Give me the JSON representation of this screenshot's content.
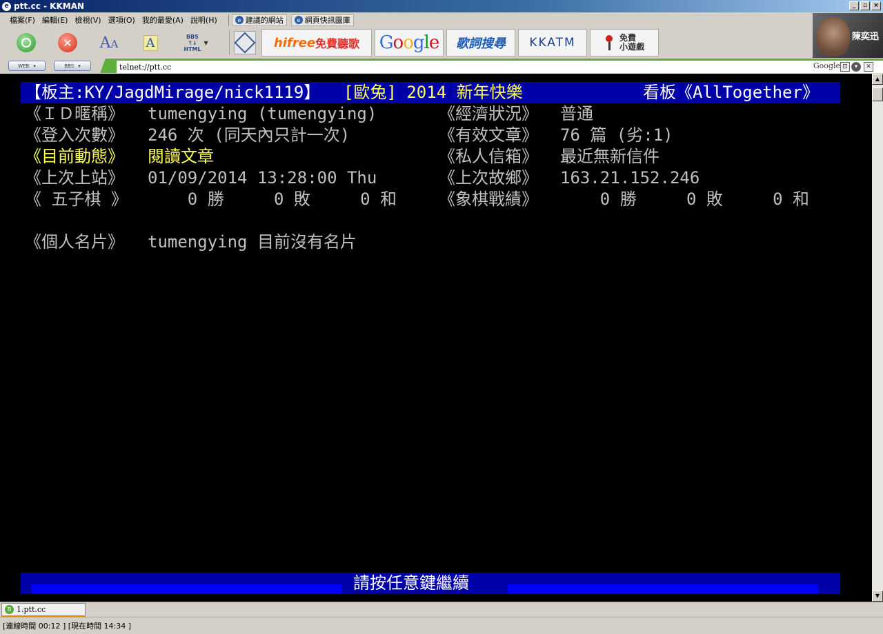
{
  "window": {
    "title": "ptt.cc - KKMAN",
    "app_icon": "kkman-icon",
    "buttons": {
      "minimize": "_",
      "maximize": "▫",
      "close": "×"
    }
  },
  "menu": {
    "items": [
      "檔案(F)",
      "編輯(E)",
      "檢視(V)",
      "選項(O)",
      "我的最愛(A)",
      "說明(H)"
    ],
    "links": [
      "建議的網站",
      "網頁快訊圖庫"
    ]
  },
  "toolbar": {
    "font_large": "A",
    "font_small": "A",
    "bbs_html": [
      "BBS",
      "↑↓",
      "HTML"
    ],
    "ads": {
      "hifree": "hifree",
      "hifree_tag": "免費聽歌",
      "google": "Google",
      "lyrics": "歌詞搜尋",
      "kkatm": "KKATM",
      "game_line1": "免費",
      "game_line2": "小遊戲"
    }
  },
  "photo": {
    "name": "陳奕迅"
  },
  "address": {
    "web_label": "WEB",
    "bbs_label": "BBS",
    "url": "telnet://ptt.cc",
    "search_engine": "Google"
  },
  "terminal": {
    "header": {
      "left": "【板主:KY/JagdMirage/nick1119】",
      "mid": "[歐兔] 2014 新年快樂",
      "right": "看板《AllTogether》"
    },
    "rows": [
      {
        "label": "《ＩＤ暱稱》",
        "value": "tumengying (tumengying)",
        "label2": "《經濟狀況》",
        "value2": "普通"
      },
      {
        "label": "《登入次數》",
        "value": "246 次 (同天內只計一次)",
        "label2": "《有效文章》",
        "value2": "76 篇 (劣:1)"
      },
      {
        "label": "《目前動態》",
        "value": "閱讀文章",
        "label2": "《私人信箱》",
        "value2": "最近無新信件"
      },
      {
        "label": "《上次上站》",
        "value": "01/09/2014 13:28:00 Thu",
        "label2": "《上次故鄉》",
        "value2": "163.21.152.246"
      },
      {
        "label": "《 五子棋 》",
        "value": "    0 勝     0 敗     0 和",
        "label2": "《象棋戰績》",
        "value2": "    0 勝     0 敗     0 和"
      }
    ],
    "card": {
      "label": "《個人名片》",
      "value": "tumengying 目前沒有名片"
    },
    "footer": "請按任意鍵繼續"
  },
  "tabs": [
    {
      "label": "1.ptt.cc"
    }
  ],
  "status": {
    "text": "[連線時間 00:12 ] [現在時間 14:34 ]"
  }
}
